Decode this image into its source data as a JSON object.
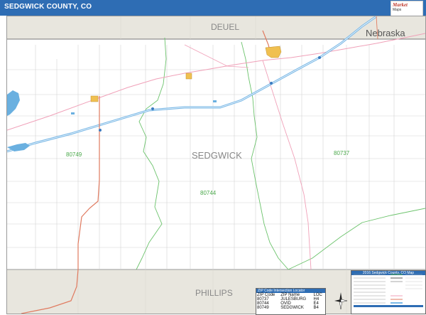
{
  "header": {
    "title": "SEDGWICK COUNTY, CO"
  },
  "logo": {
    "line1": "Market",
    "line2": "Maps"
  },
  "map": {
    "main_county": "SEDGWICK",
    "neighbors": {
      "north": "DEUEL",
      "south": "PHILLIPS"
    },
    "state_label": "Nebraska",
    "zip_labels": [
      "80749",
      "80744",
      "80737"
    ]
  },
  "zip_locator": {
    "title": "ZIP Code Intersection Locator",
    "columns": [
      "ZIP Code",
      "ZIP Name",
      "LOC"
    ],
    "rows": [
      [
        "80737",
        "JULESBURG",
        "H4"
      ],
      [
        "80744",
        "OVID",
        "E4"
      ],
      [
        "80749",
        "SEDGWICK",
        "B4"
      ]
    ]
  },
  "legend": {
    "title": "2016 Sedgwick County, CO Map"
  },
  "colors": {
    "title_bar": "#2e6db4",
    "zip_boundary": "#4aa84a",
    "interstate": "#6ab0e0",
    "highway": "#e07a5f",
    "road": "#c8c8c8",
    "neighbor_fill": "#e8e6de",
    "water": "#6ab0e0"
  }
}
